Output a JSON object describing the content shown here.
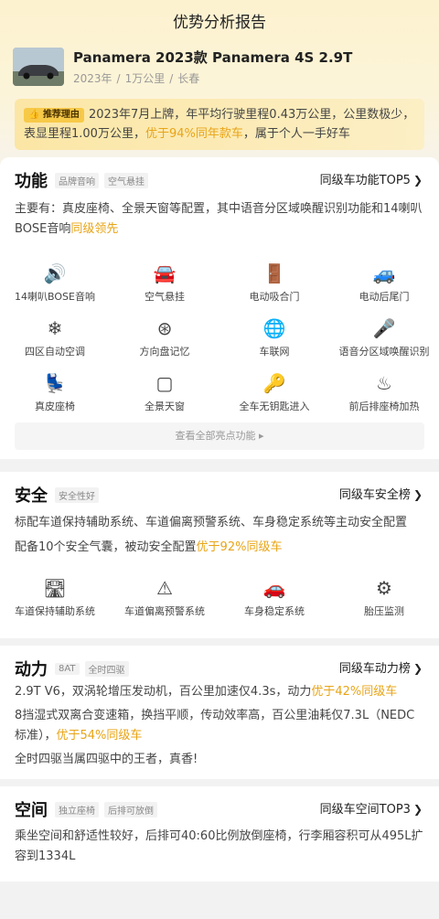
{
  "page": {
    "title": "优势分析报告"
  },
  "car": {
    "title": "Panamera 2023款 Panamera 4S 2.9T",
    "year": "2023年",
    "mileage": "1万公里",
    "city": "长春"
  },
  "recommend": {
    "tag": "推荐理由",
    "text1": "2023年7月上牌，年平均行驶里程0.43万公里，公里数极少，表显里程1.00万公里，",
    "highlight": "优于94%同年款车",
    "text2": "，属于个人一手好车"
  },
  "features": {
    "title": "功能",
    "tags": [
      "品牌音响",
      "空气悬挂"
    ],
    "rank": "同级车功能TOP5",
    "desc1": "主要有：真皮座椅、全景天窗等配置，其中语音分区域唤醒识别功能和14喇叭BOSE音响",
    "desc_hl": "同级领先",
    "items": [
      {
        "label": "14喇叭BOSE音响",
        "icon": "speaker-icon",
        "glyph": "🔊"
      },
      {
        "label": "空气悬挂",
        "icon": "air-suspension-icon",
        "glyph": "🚘"
      },
      {
        "label": "电动吸合门",
        "icon": "soft-close-door-icon",
        "glyph": "🚪"
      },
      {
        "label": "电动后尾门",
        "icon": "power-tailgate-icon",
        "glyph": "🚙"
      },
      {
        "label": "四区自动空调",
        "icon": "air-conditioner-icon",
        "glyph": "❄"
      },
      {
        "label": "方向盘记忆",
        "icon": "steering-wheel-icon",
        "glyph": "⊛"
      },
      {
        "label": "车联网",
        "icon": "globe-icon",
        "glyph": "🌐"
      },
      {
        "label": "语音分区域唤醒识别",
        "icon": "microphone-icon",
        "glyph": "🎤"
      },
      {
        "label": "真皮座椅",
        "icon": "leather-seat-icon",
        "glyph": "💺"
      },
      {
        "label": "全景天窗",
        "icon": "sunroof-icon",
        "glyph": "▢"
      },
      {
        "label": "全车无钥匙进入",
        "icon": "keyless-entry-icon",
        "glyph": "🔑"
      },
      {
        "label": "前后排座椅加热",
        "icon": "seat-heating-icon",
        "glyph": "♨"
      }
    ],
    "more": "查看全部亮点功能 ▸"
  },
  "safety": {
    "title": "安全",
    "tags": [
      "安全性好"
    ],
    "rank": "同级车安全榜",
    "desc1": "标配车道保持辅助系统、车道偏离预警系统、车身稳定系统等主动安全配置",
    "desc2": "配备10个安全气囊，被动安全配置",
    "desc2_hl": "优于92%同级车",
    "items": [
      {
        "label": "车道保持辅助系统",
        "icon": "lane-keep-icon",
        "glyph": "🛣"
      },
      {
        "label": "车道偏离预警系统",
        "icon": "lane-departure-icon",
        "glyph": "⚠"
      },
      {
        "label": "车身稳定系统",
        "icon": "stability-control-icon",
        "glyph": "🚗"
      },
      {
        "label": "胎压监测",
        "icon": "tire-pressure-icon",
        "glyph": "⚙"
      }
    ]
  },
  "power": {
    "title": "动力",
    "tags": [
      "8AT",
      "全时四驱"
    ],
    "rank": "同级车动力榜",
    "line1": "2.9T V6，双涡轮增压发动机，百公里加速仅4.3s，动力",
    "line1_hl": "优于42%同级车",
    "line2": "8挡湿式双离合变速箱，换挡平顺，传动效率高，百公里油耗仅7.3L（NEDC标准），",
    "line2_hl": "优于54%同级车",
    "line3": "全时四驱当属四驱中的王者，真香!"
  },
  "space": {
    "title": "空间",
    "tags": [
      "独立座椅",
      "后排可放倒"
    ],
    "rank": "同级车空间TOP3",
    "desc": "乘坐空间和舒适性较好，后排可40:60比例放倒座椅，行李厢容积可从495L扩容到1334L"
  }
}
